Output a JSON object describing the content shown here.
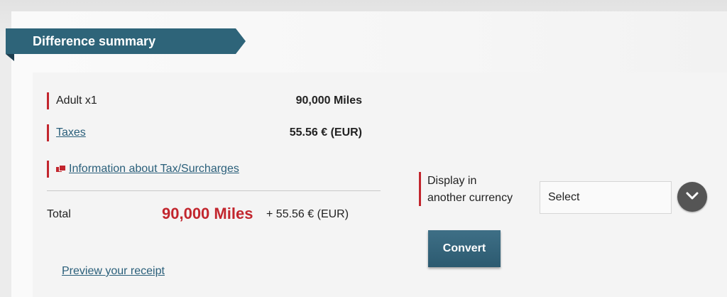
{
  "header": {
    "title": "Difference summary"
  },
  "summary": {
    "adult": {
      "label": "Adult x1",
      "value": "90,000 Miles"
    },
    "taxes": {
      "label": "Taxes",
      "value": "55.56 € (EUR)"
    },
    "info_link": "Information about Tax/Surcharges",
    "total": {
      "label": "Total",
      "miles": "90,000 Miles",
      "extra": "+ 55.56 € (EUR)"
    },
    "preview_link": "Preview your receipt"
  },
  "currency": {
    "label_line1": "Display in",
    "label_line2": "another currency",
    "select_value": "Select",
    "convert_label": "Convert"
  },
  "colors": {
    "accent": "#c2262e",
    "brand": "#2c5a70"
  }
}
